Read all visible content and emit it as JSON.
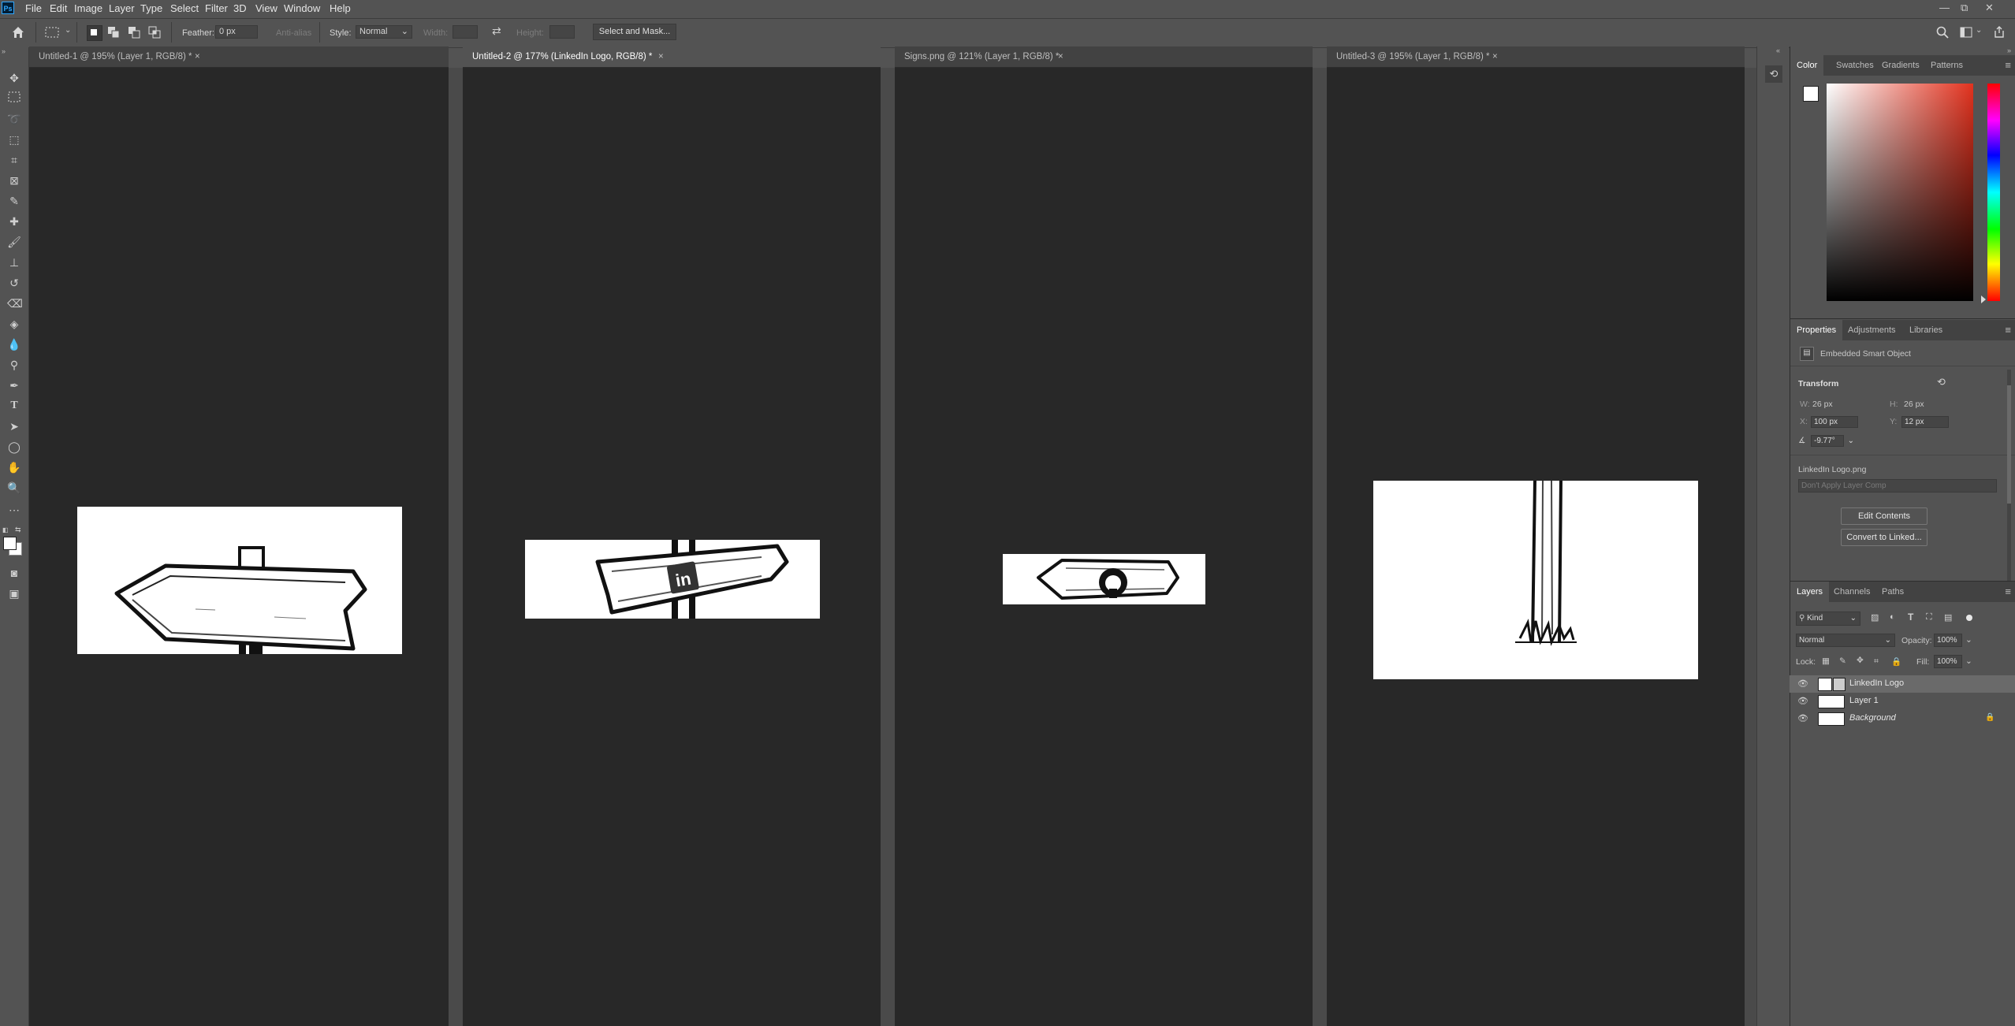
{
  "app": {
    "logo_text": "Ps"
  },
  "menu": [
    "File",
    "Edit",
    "Image",
    "Layer",
    "Type",
    "Select",
    "Filter",
    "3D",
    "View",
    "Window",
    "Help"
  ],
  "window_controls": {
    "minimize": "—",
    "restore": "⧉",
    "close": "✕"
  },
  "options_bar": {
    "feather_label": "Feather:",
    "feather_value": "0 px",
    "antialias_label": "Anti-alias",
    "style_label": "Style:",
    "style_value": "Normal",
    "width_label": "Width:",
    "height_label": "Height:",
    "select_mask_label": "Select and Mask..."
  },
  "documents": [
    {
      "title": "Untitled-1 @ 195% (Layer 1, RGB/8) *",
      "active": false
    },
    {
      "title": "Untitled-2 @ 177% (LinkedIn Logo, RGB/8) *",
      "active": true
    },
    {
      "title": "Signs.png @ 121% (Layer 1, RGB/8) *",
      "active": false
    },
    {
      "title": "Untitled-3 @ 195% (Layer 1, RGB/8) *",
      "active": false
    }
  ],
  "tab_close_glyph": "×",
  "color_panel": {
    "tabs": [
      "Color",
      "Swatches",
      "Gradients",
      "Patterns"
    ]
  },
  "properties_panel": {
    "tabs": [
      "Properties",
      "Adjustments",
      "Libraries"
    ],
    "object_type": "Embedded Smart Object",
    "transform_label": "Transform",
    "w_label": "W:",
    "w_value": "26 px",
    "h_label": "H:",
    "h_value": "26 px",
    "x_label": "X:",
    "x_value": "100 px",
    "y_label": "Y:",
    "y_value": "12 px",
    "angle_value": "-9.77°",
    "filename": "LinkedIn Logo.png",
    "layer_comp_placeholder": "Don't Apply Layer Comp",
    "edit_contents_label": "Edit Contents",
    "convert_label": "Convert to Linked..."
  },
  "layers_panel": {
    "tabs": [
      "Layers",
      "Channels",
      "Paths"
    ],
    "kind_label": "Kind",
    "blend_mode": "Normal",
    "opacity_label": "Opacity:",
    "opacity_value": "100%",
    "lock_label": "Lock:",
    "fill_label": "Fill:",
    "fill_value": "100%",
    "layers": [
      {
        "name": "LinkedIn Logo",
        "selected": true
      },
      {
        "name": "Layer 1",
        "selected": false
      },
      {
        "name": "Background",
        "selected": false,
        "locked": true
      }
    ]
  },
  "canvas_art": {
    "linkedin_mark": "in"
  }
}
